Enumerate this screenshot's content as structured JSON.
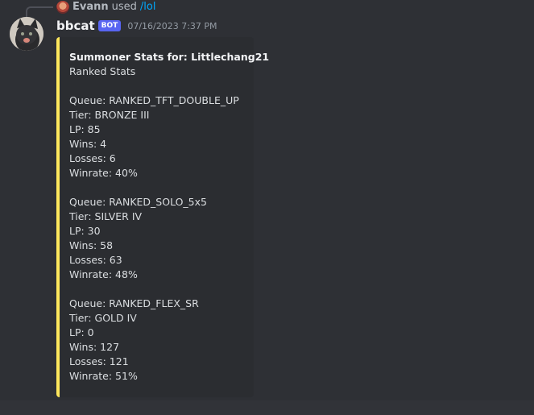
{
  "reply": {
    "user": "Evann",
    "text": "used",
    "command": "/lol"
  },
  "message": {
    "username": "bbcat",
    "bot_tag": "BOT",
    "timestamp": "07/16/2023 7:37 PM"
  },
  "embed": {
    "accent_color": "#fee75c",
    "title": "Summoner Stats for: Littlechang21",
    "lines": [
      "Ranked Stats",
      "",
      "Queue: RANKED_TFT_DOUBLE_UP",
      "Tier: BRONZE III",
      "LP: 85",
      "Wins: 4",
      "Losses: 6",
      "Winrate: 40%",
      "",
      "Queue: RANKED_SOLO_5x5",
      "Tier: SILVER IV",
      "LP: 30",
      "Wins: 58",
      "Losses: 63",
      "Winrate: 48%",
      "",
      "Queue: RANKED_FLEX_SR",
      "Tier: GOLD IV",
      "LP: 0",
      "Wins: 127",
      "Losses: 121",
      "Winrate: 51%"
    ]
  },
  "colors": {
    "background": "#313338",
    "message_hover": "#2e3035",
    "embed_bg": "#2b2d31",
    "bot_tag": "#5865f2",
    "link": "#00a8fc"
  }
}
